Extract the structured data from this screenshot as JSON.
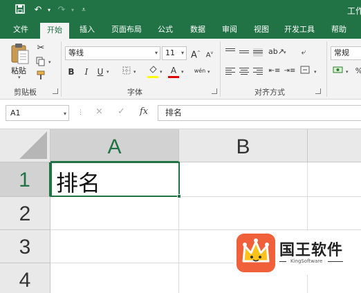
{
  "title_bar": {
    "title": "工作",
    "qa_icons": [
      "save-icon",
      "undo-icon",
      "redo-icon",
      "customize-icon"
    ]
  },
  "ribbon_tabs": [
    "文件",
    "开始",
    "插入",
    "页面布局",
    "公式",
    "数据",
    "审阅",
    "视图",
    "开发工具",
    "帮助"
  ],
  "active_tab": "开始",
  "clipboard": {
    "paste_label": "粘贴",
    "group_label": "剪贴板"
  },
  "font": {
    "family": "等线",
    "size": "11",
    "grow_label": "A",
    "shrink_label": "A",
    "bold_label": "B",
    "italic_label": "I",
    "underline_label": "U",
    "font_color_label": "A",
    "phonetic_label": "wén",
    "group_label": "字体",
    "highlight_color": "#ffff00",
    "font_color": "#e00000"
  },
  "alignment": {
    "group_label": "对齐方式"
  },
  "number": {
    "format": "常规"
  },
  "formula_bar": {
    "name_box": "A1",
    "cancel_icon": "×",
    "enter_icon": "✓",
    "fx_label": "fx",
    "formula": "排名"
  },
  "sheet": {
    "columns": [
      "A",
      "B"
    ],
    "rows": [
      "1",
      "2",
      "3",
      "4"
    ],
    "active_cell": "A1",
    "cells": {
      "A1": "排名"
    }
  },
  "watermark": {
    "name": "国王软件",
    "sub": "KingSoftware"
  },
  "colors": {
    "accent": "#217346",
    "ribbon_bg": "#f3f3f3",
    "header_bg": "#e9e9e9",
    "logo_bg": "#f0603a",
    "crown": "#ffc21a"
  }
}
